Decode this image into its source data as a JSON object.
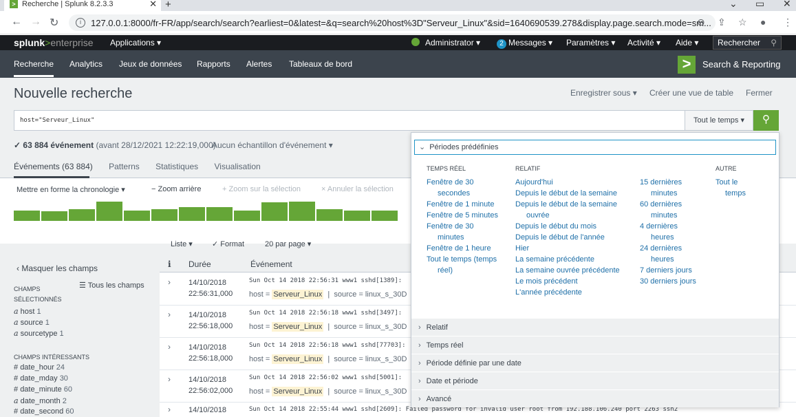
{
  "browser": {
    "tab_title": "Recherche | Splunk 8.2.3.3",
    "tab_favicon": ">",
    "url": "127.0.0.1:8000/fr-FR/app/search/search?earliest=0&latest=&q=search%20host%3D\"Serveur_Linux\"&sid=1640690539.278&display.page.search.mode=sm..."
  },
  "splunk": {
    "logo_main": "splunk",
    "logo_gt": ">",
    "logo_sub": "enterprise",
    "apps_menu": "Applications ▾",
    "admin": "Administrator ▾",
    "messages_count": "2",
    "messages": "Messages ▾",
    "settings": "Paramètres ▾",
    "activity": "Activité ▾",
    "help": "Aide ▾",
    "top_search": "Rechercher"
  },
  "nav": {
    "items": [
      "Recherche",
      "Analytics",
      "Jeux de données",
      "Rapports",
      "Alertes",
      "Tableaux de bord"
    ],
    "app_icon": ">",
    "app_name": "Search & Reporting"
  },
  "page": {
    "title": "Nouvelle recherche",
    "save_as": "Enregistrer sous ▾",
    "create_table": "Créer une vue de table",
    "close": "Fermer"
  },
  "search": {
    "query": "host=\"Serveur_Linux\"",
    "time_range": "Tout le temps ▾"
  },
  "status": {
    "count": "✓ 63 884 événement",
    "before": "(avant 28/12/2021 12:22:19,000)",
    "sampling": "Aucun échantillon d'événement ▾"
  },
  "tabs": [
    "Événements (63 884)",
    "Patterns",
    "Statistiques",
    "Visualisation"
  ],
  "timeline": {
    "format": "Mettre en forme la chronologie ▾",
    "zoom_out": "− Zoom arrière",
    "zoom_sel": "+ Zoom sur la sélection",
    "cancel_sel": "× Annuler la sélection",
    "bar_levels": [
      0.55,
      0.5,
      0.6,
      1.0,
      0.55,
      0.6,
      0.7,
      0.7,
      0.55,
      0.95,
      1.0,
      0.6,
      0.55,
      0.55
    ]
  },
  "list_controls": {
    "list": "Liste ▾",
    "format": "✓ Format",
    "per_page": "20 par page ▾"
  },
  "sidebar": {
    "hide": "‹ Masquer les champs",
    "all_fields": "☰ Tous les champs",
    "selected_hdr_1": "CHAMPS",
    "selected_hdr_2": "SÉLECTIONNÉS",
    "selected": [
      {
        "prefix": "a",
        "name": "host",
        "count": "1"
      },
      {
        "prefix": "a",
        "name": "source",
        "count": "1"
      },
      {
        "prefix": "a",
        "name": "sourcetype",
        "count": "1"
      }
    ],
    "interesting_hdr": "CHAMPS INTÉRESSANTS",
    "interesting": [
      {
        "prefix": "#",
        "name": "date_hour",
        "count": "24"
      },
      {
        "prefix": "#",
        "name": "date_mday",
        "count": "30"
      },
      {
        "prefix": "#",
        "name": "date_minute",
        "count": "60"
      },
      {
        "prefix": "a",
        "name": "date_month",
        "count": "2"
      },
      {
        "prefix": "#",
        "name": "date_second",
        "count": "60"
      }
    ]
  },
  "table": {
    "col_i": "i",
    "col_time": "Durée",
    "col_event": "Événement",
    "rows": [
      {
        "date": "14/10/2018",
        "time": "22:56:31,000",
        "raw": "Sun Oct 14 2018 22:56:31 www1 sshd[1389]:",
        "host_label": "host =",
        "host": "Serveur_Linux",
        "source": "source = linux_s_30D"
      },
      {
        "date": "14/10/2018",
        "time": "22:56:18,000",
        "raw": "Sun Oct 14 2018 22:56:18 www1 sshd[3497]:",
        "host_label": "host =",
        "host": "Serveur_Linux",
        "source": "source = linux_s_30D"
      },
      {
        "date": "14/10/2018",
        "time": "22:56:18,000",
        "raw": "Sun Oct 14 2018 22:56:18 www1 sshd[77703]:",
        "host_label": "host =",
        "host": "Serveur_Linux",
        "source": "source = linux_s_30D"
      },
      {
        "date": "14/10/2018",
        "time": "22:56:02,000",
        "raw": "Sun Oct 14 2018 22:56:02 www1 sshd[5001]:",
        "host_label": "host =",
        "host": "Serveur_Linux",
        "source": "source = linux_s_30D"
      },
      {
        "date": "14/10/2018",
        "time": "",
        "raw": "Sun Oct 14 2018 22:55:44 www1 sshd[2609]: Failed password for invalid user root from 192.188.106.240 port 2263 ssh2",
        "host_label": "",
        "host": "",
        "source": ""
      }
    ]
  },
  "dropdown": {
    "header": "Périodes prédéfinies",
    "col_realtime": "TEMPS RÉEL",
    "col_relative": "RELATIF",
    "col_other": "AUTRE",
    "realtime": [
      "Fenêtre de 30",
      "secondes",
      "Fenêtre de 1 minute",
      "Fenêtre de 5 minutes",
      "Fenêtre de 30",
      "minutes",
      "Fenêtre de 1 heure",
      "Tout le temps (temps",
      "réel)"
    ],
    "relative_a": [
      "Aujourd'hui",
      "Depuis le début de la semaine",
      "Depuis le début de la semaine",
      "ouvrée",
      "Depuis le début du mois",
      "Depuis le début de l'année",
      "Hier",
      "La semaine précédente",
      "La semaine ouvrée précédente",
      "Le mois précédent",
      "L'année précédente"
    ],
    "relative_b": [
      "15 dernières",
      "minutes",
      "60 dernières",
      "minutes",
      "4 dernières",
      "heures",
      "24 dernières",
      "heures",
      "7 derniers jours",
      "30 derniers jours"
    ],
    "other": [
      "Tout le",
      "temps"
    ],
    "sections": [
      "Relatif",
      "Temps réel",
      "Période définie par une date",
      "Date et période",
      "Avancé"
    ]
  },
  "colors": {
    "accent_green": "#65a637",
    "link_blue": "#1e6fa8",
    "header_dark": "#1a1c20",
    "nav_gray": "#3c444d"
  }
}
